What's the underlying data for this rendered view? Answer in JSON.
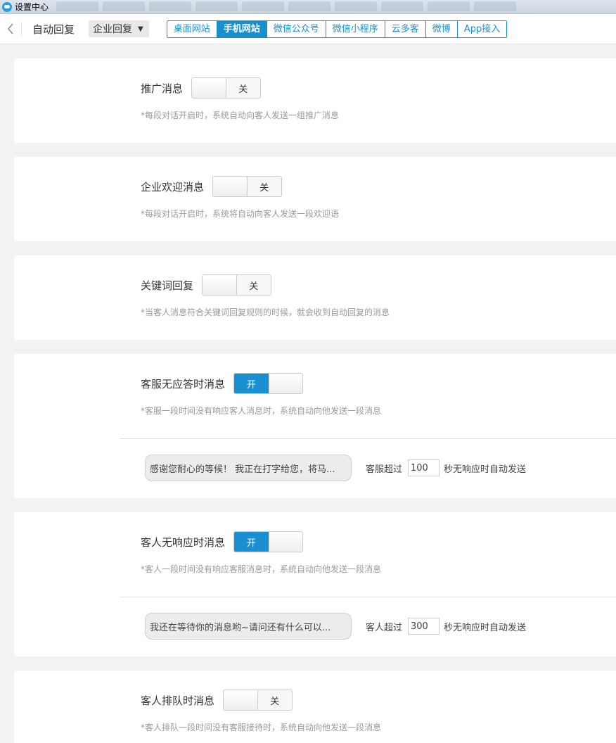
{
  "window": {
    "title": "设置中心"
  },
  "toolbar": {
    "page_title": "自动回复",
    "enterprise_select": "企业回复"
  },
  "tabs": [
    {
      "label": "桌面网站",
      "active": false
    },
    {
      "label": "手机网站",
      "active": true
    },
    {
      "label": "微信公众号",
      "active": false
    },
    {
      "label": "微信小程序",
      "active": false
    },
    {
      "label": "云多客",
      "active": false
    },
    {
      "label": "微博",
      "active": false
    },
    {
      "label": "App接入",
      "active": false
    }
  ],
  "toggle_labels": {
    "on": "开",
    "off": "关"
  },
  "settings": [
    {
      "label": "推广消息",
      "enabled": false,
      "desc": "*每段对话开启时，系统自动向客人发送一组推广消息"
    },
    {
      "label": "企业欢迎消息",
      "enabled": false,
      "desc": "*每段对话开启时，系统将自动向客人发送一段欢迎语"
    },
    {
      "label": "关键词回复",
      "enabled": false,
      "desc": "*当客人消息符合关键词回复规则的时候，就会收到自动回复的消息"
    },
    {
      "label": "客服无应答时消息",
      "enabled": true,
      "desc": "*客服一段时间没有响应客人消息时，系统自动向他发送一段消息",
      "message": "感谢您耐心的等候！ 我正在打字给您，将马...",
      "timeout_prefix": "客服超过",
      "timeout_value": "100",
      "timeout_suffix": "秒无响应时自动发送"
    },
    {
      "label": "客人无响应时消息",
      "enabled": true,
      "desc": "*客人一段时间没有响应客服消息时，系统自动向他发送一段消息",
      "message": "我还在等待你的消息哟~请问还有什么可以...",
      "timeout_prefix": "客人超过",
      "timeout_value": "300",
      "timeout_suffix": "秒无响应时自动发送"
    },
    {
      "label": "客人排队时消息",
      "enabled": false,
      "desc": "*客人排队一段时间没有客服接待时，系统自动向他发送一段消息"
    }
  ]
}
